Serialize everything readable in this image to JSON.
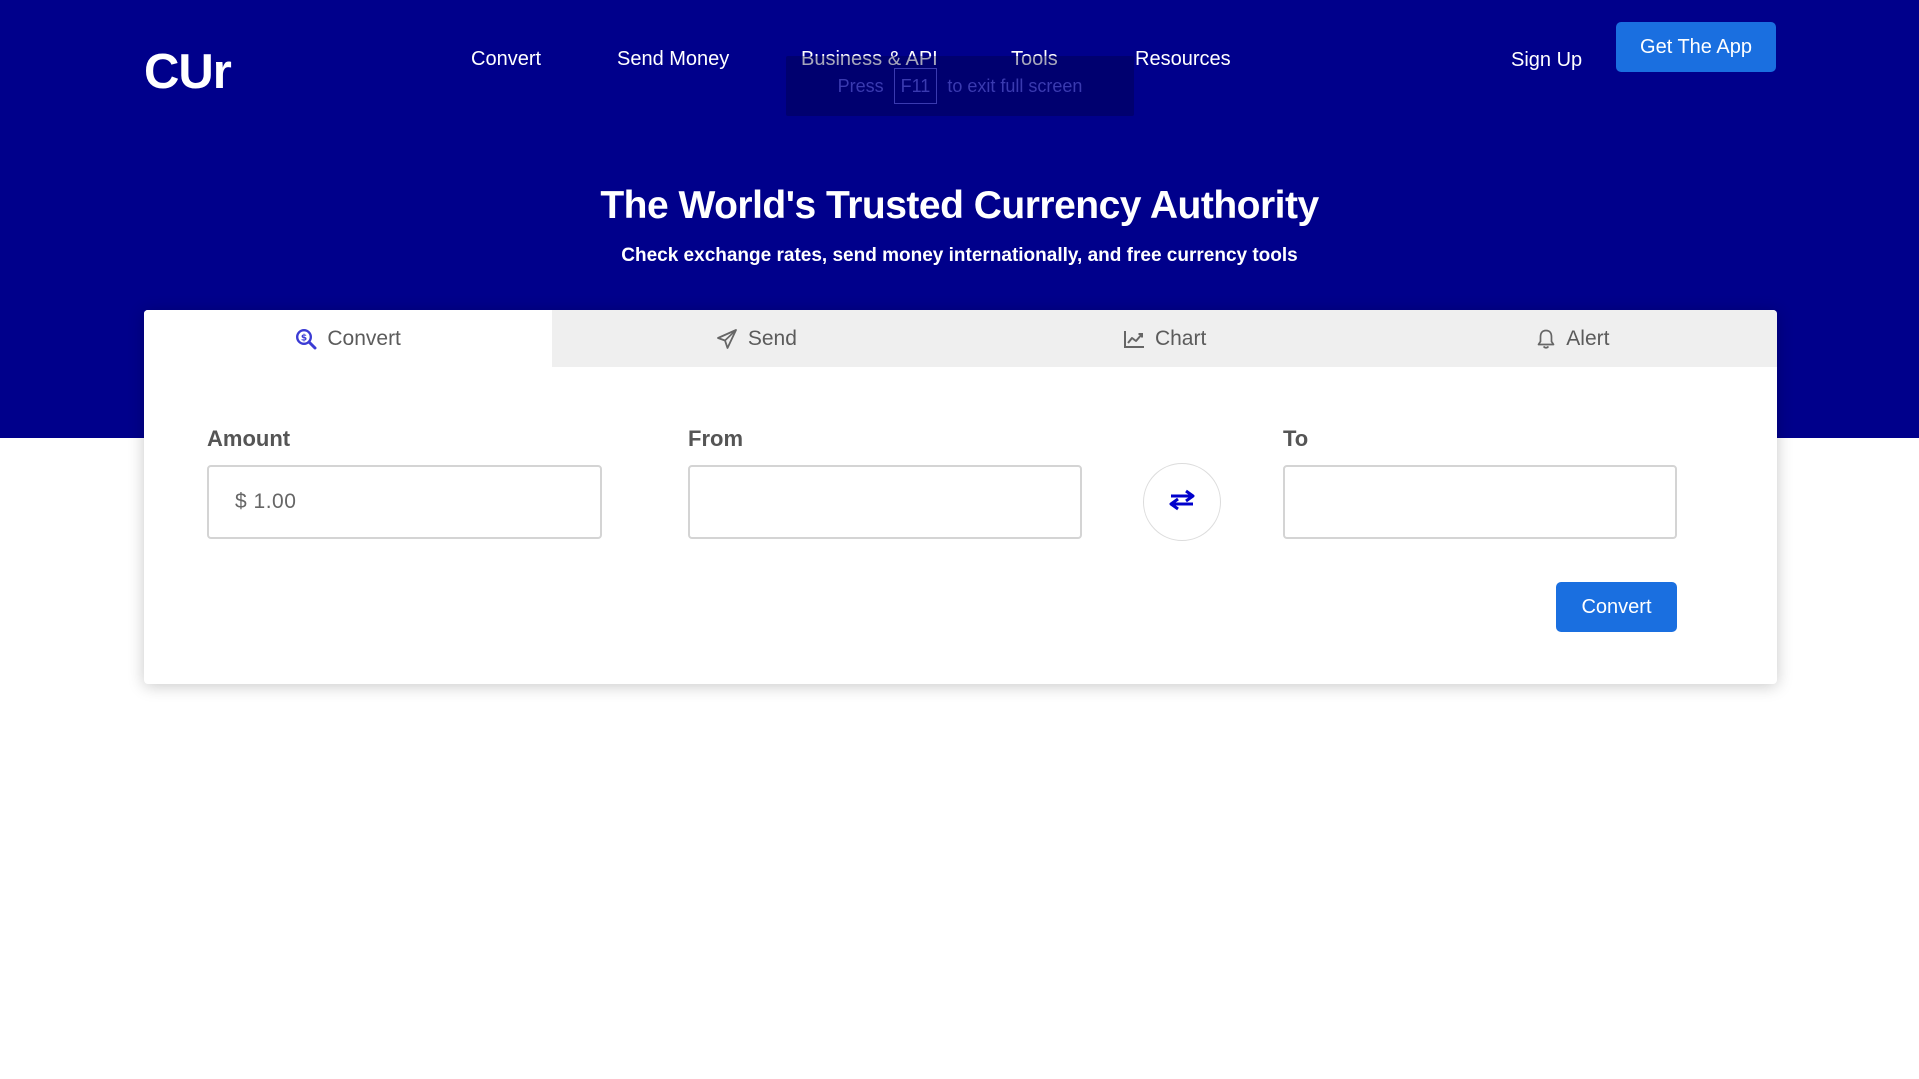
{
  "header": {
    "logo": "CUr",
    "nav": [
      "Convert",
      "Send Money",
      "Business & API",
      "Tools",
      "Resources"
    ],
    "sign_up": "Sign Up",
    "get_app": "Get The App"
  },
  "fullscreen_hint": {
    "press": "Press",
    "key": "F11",
    "rest": "to exit full screen"
  },
  "hero": {
    "title": "The World's Trusted Currency Authority",
    "subtitle": "Check exchange rates, send money internationally, and free currency tools"
  },
  "tabs": [
    {
      "label": "Convert",
      "icon": "search-dollar-icon",
      "active": true
    },
    {
      "label": "Send",
      "icon": "paper-plane-icon",
      "active": false
    },
    {
      "label": "Chart",
      "icon": "line-chart-icon",
      "active": false
    },
    {
      "label": "Alert",
      "icon": "bell-icon",
      "active": false
    }
  ],
  "form": {
    "amount_label": "Amount",
    "amount_value": "$ 1.00",
    "from_label": "From",
    "from_value": "",
    "to_label": "To",
    "to_value": "",
    "swap_icon": "swap-arrows-icon",
    "convert_button": "Convert"
  },
  "colors": {
    "hero_bg": "#00008b",
    "primary_button": "#1a6fe0",
    "active_tab_icon": "#3b3bd4",
    "swap_icon": "#0000cc"
  }
}
